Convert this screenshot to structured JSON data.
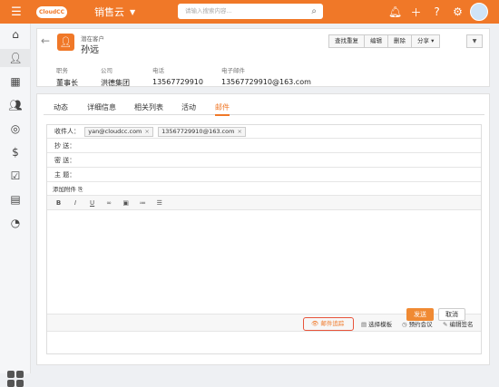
{
  "topbar": {
    "logo": "CloudCC",
    "app_name": "销售云",
    "search_placeholder": "请输入搜索内容..."
  },
  "record": {
    "object_type": "潜在客户",
    "name": "孙远",
    "buttons": [
      "查找重复",
      "编辑",
      "删除",
      "分享"
    ],
    "fields": [
      {
        "label": "职务",
        "value": "董事长"
      },
      {
        "label": "公司",
        "value": "洪德集团"
      },
      {
        "label": "电话",
        "value": "13567729910"
      },
      {
        "label": "电子邮件",
        "value": "13567729910@163.com"
      }
    ]
  },
  "tabs": [
    {
      "label": "动态",
      "active": false
    },
    {
      "label": "详细信息",
      "active": false
    },
    {
      "label": "相关列表",
      "active": false
    },
    {
      "label": "活动",
      "active": false
    },
    {
      "label": "邮件",
      "active": true
    }
  ],
  "email": {
    "to_label": "收件人：",
    "recipients": [
      "yan@cloudcc.com",
      "13567729910@163.com"
    ],
    "cc_label": "抄  送：",
    "bcc_label": "密  送：",
    "subject_label": "主  题：",
    "attach_label": "添加附件",
    "options": {
      "track": "邮件追踪",
      "template": "选择模板",
      "meeting": "预约会议",
      "signature": "编辑签名"
    },
    "send_label": "发送",
    "cancel_label": "取消"
  },
  "accent_color": "#f07828"
}
